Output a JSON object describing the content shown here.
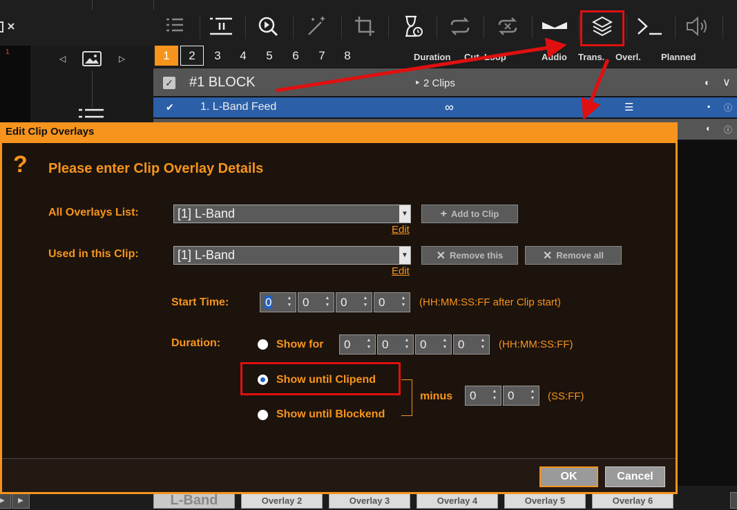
{
  "toolbar": {
    "icons": [
      "list-icon",
      "pause-list-icon",
      "search-icon",
      "magic-wand-icon",
      "crop-icon",
      "hourglass-clock-icon",
      "loop-icon",
      "shuffle-off-icon",
      "transition-icon",
      "layers-icon",
      "terminal-icon",
      "volume-icon"
    ],
    "left_number": "1"
  },
  "page_tabs": [
    "1",
    "2",
    "3",
    "4",
    "5",
    "6",
    "7",
    "8"
  ],
  "columns": {
    "duration": "Duration",
    "cut": "Cut",
    "loop": "Loop",
    "audio": "Audio",
    "trans": "Trans.",
    "overl": "Overl.",
    "planned": "Planned"
  },
  "block": {
    "title": "#1  BLOCK",
    "clips": "‣ 2 Clips"
  },
  "clip": {
    "name": "1. L-Band Feed",
    "duration": "∞"
  },
  "dialog": {
    "title": "Edit Clip Overlays",
    "headline": "Please enter Clip Overlay Details",
    "all_overlays_label": "All Overlays List:",
    "all_overlays_value": "[1] L-Band",
    "used_label": "Used in this Clip:",
    "used_value": "[1] L-Band",
    "edit_link": "Edit",
    "add_to_clip": "Add to Clip",
    "remove_this": "Remove this",
    "remove_all": "Remove all",
    "start_time_label": "Start Time:",
    "start_time": [
      "0",
      "0",
      "0",
      "0"
    ],
    "start_time_hint": "(HH:MM:SS:FF after Clip start)",
    "duration_label": "Duration:",
    "show_for": "Show for",
    "show_for_values": [
      "0",
      "0",
      "0",
      "0"
    ],
    "show_for_hint": "(HH:MM:SS:FF)",
    "show_until_clipend": "Show until Clipend",
    "show_until_blockend": "Show until Blockend",
    "minus": "minus",
    "minus_values": [
      "0",
      "0"
    ],
    "minus_hint": "(SS:FF)",
    "ok": "OK",
    "cancel": "Cancel"
  },
  "overlay_buttons": [
    "L-Band",
    "Overlay 2",
    "Overlay 3",
    "Overlay 4",
    "Overlay 5",
    "Overlay 6"
  ],
  "colors": {
    "accent": "#f7941d",
    "highlight": "#e01010",
    "selection": "#2b5fa8"
  }
}
